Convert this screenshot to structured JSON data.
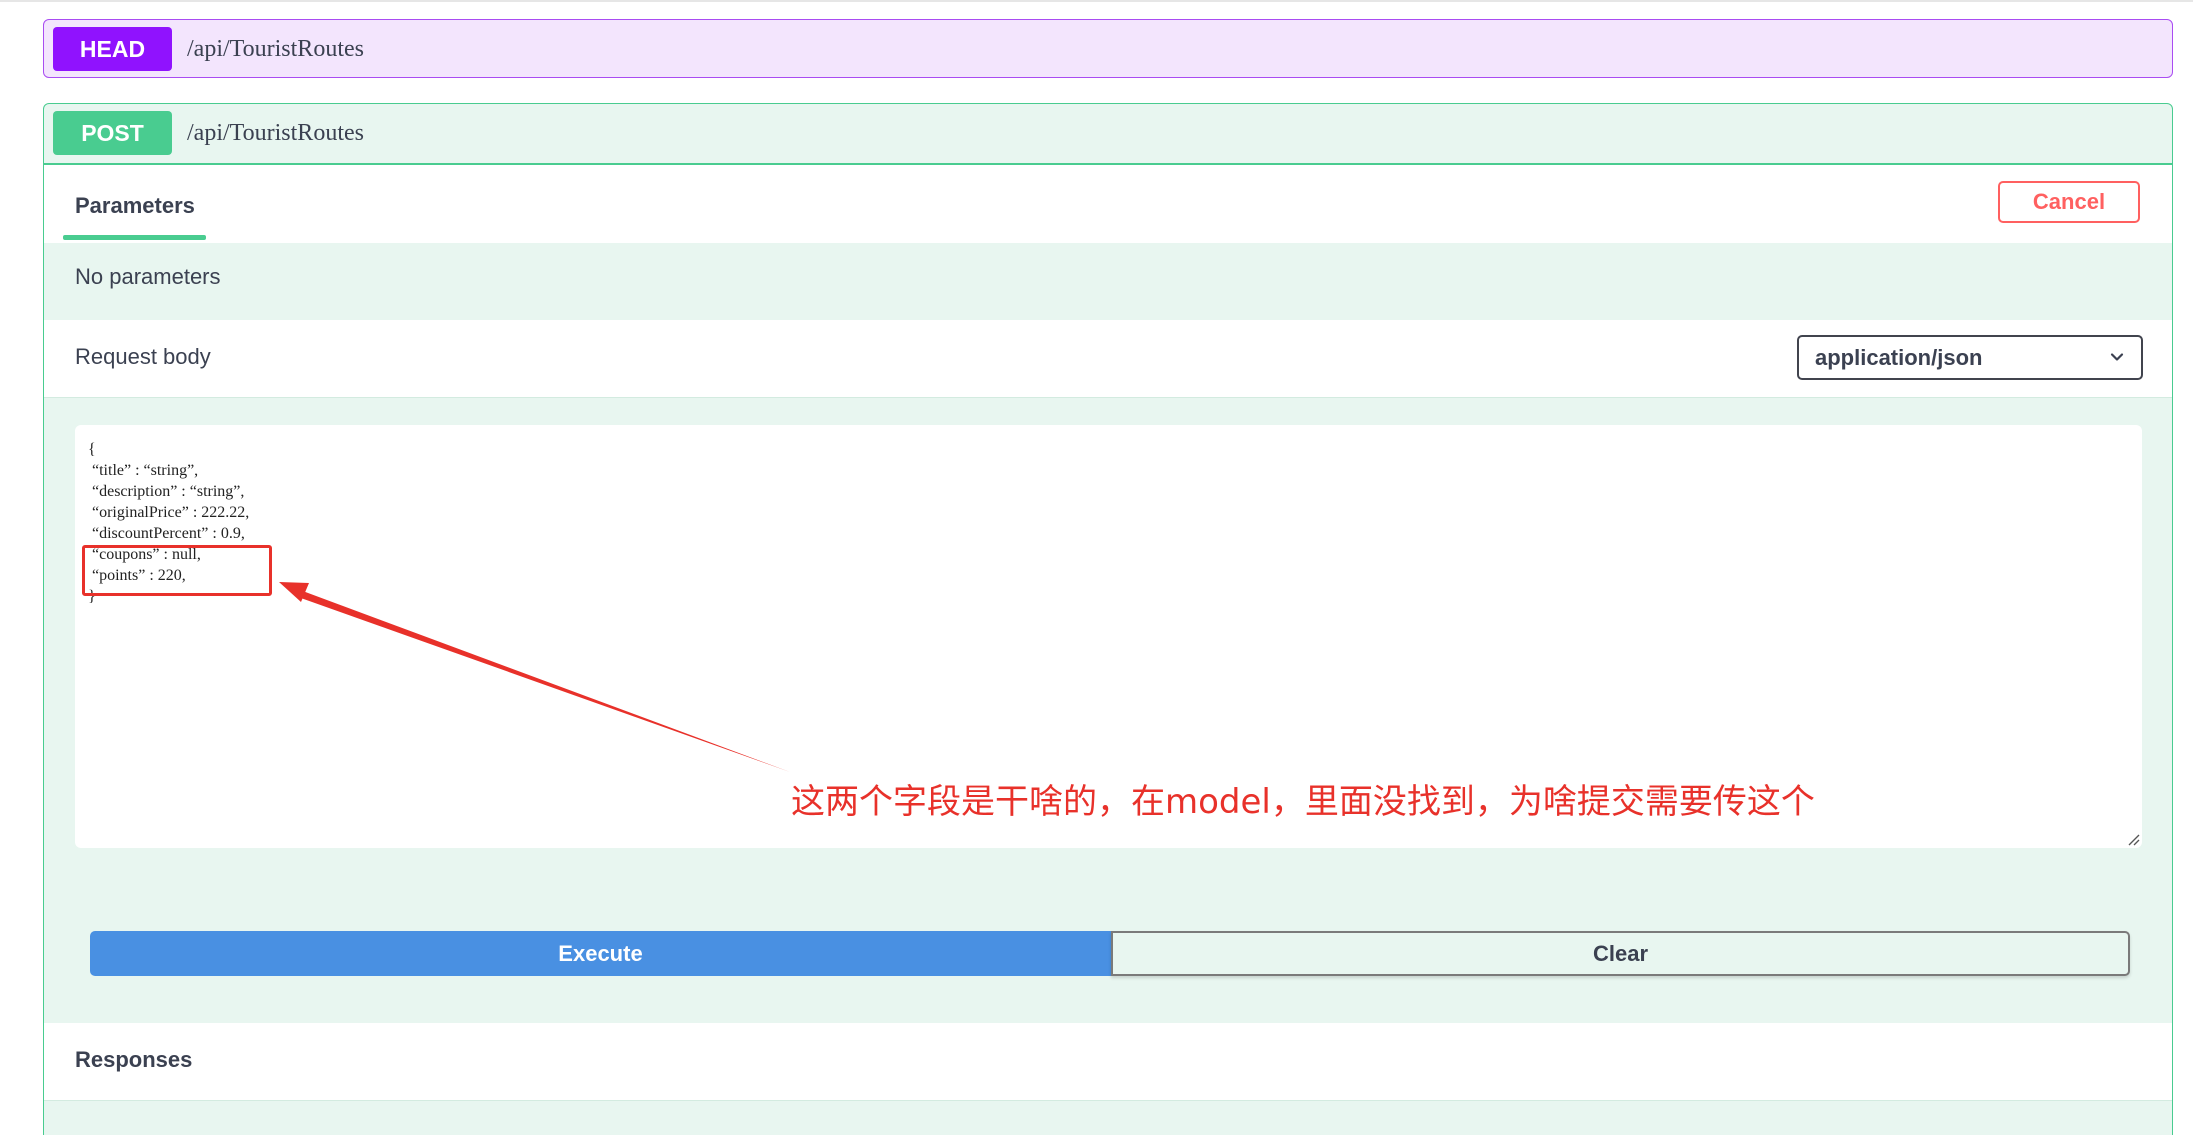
{
  "operations": {
    "head": {
      "method": "HEAD",
      "path": "/api/TouristRoutes",
      "color": "#9012fe"
    },
    "post": {
      "method": "POST",
      "path": "/api/TouristRoutes",
      "color": "#49cc90"
    }
  },
  "parameters": {
    "tab_label": "Parameters",
    "cancel_label": "Cancel",
    "empty_text": "No parameters"
  },
  "request_body": {
    "label": "Request body",
    "content_type": "application/json",
    "code_lines": [
      "{",
      " “title” : “string”,",
      " “description” : “string”,",
      " “originalPrice” : 222.22,",
      " “discountPercent” : 0.9,",
      " “coupons” : null,",
      " “points” : 220,",
      "}"
    ]
  },
  "actions": {
    "execute_label": "Execute",
    "clear_label": "Clear"
  },
  "responses": {
    "label": "Responses"
  },
  "annotation": {
    "text": "这两个字段是干啥的，在model，里面没找到，为啥提交需要传这个",
    "color": "#e8312a"
  }
}
